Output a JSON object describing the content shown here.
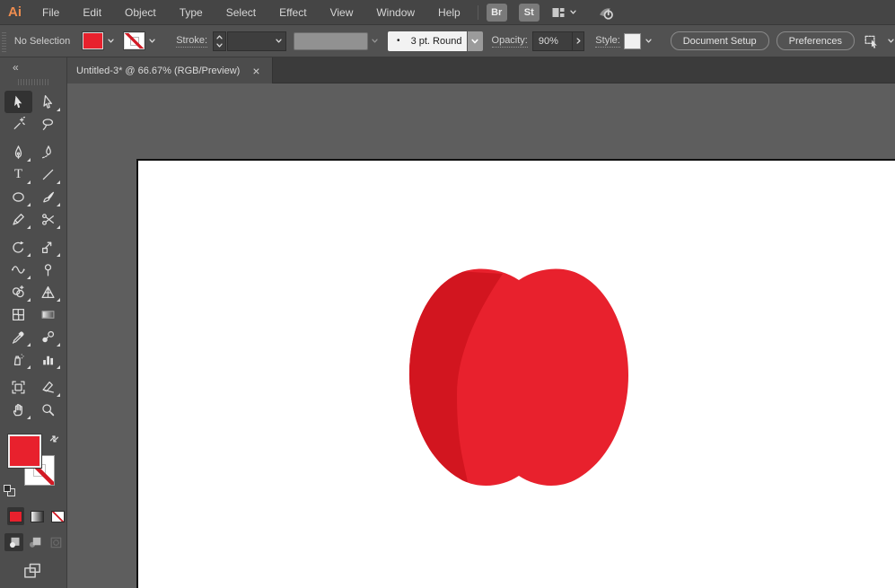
{
  "menubar": {
    "logo_label": "Ai",
    "items": [
      "File",
      "Edit",
      "Object",
      "Type",
      "Select",
      "Effect",
      "View",
      "Window",
      "Help"
    ],
    "bridge_label": "Br",
    "stock_label": "St"
  },
  "controlbar": {
    "selection_status": "No Selection",
    "stroke_label": "Stroke:",
    "brush_dot": "•",
    "brush_name": "3 pt. Round",
    "opacity_label": "Opacity:",
    "opacity_value": "90%",
    "style_label": "Style:",
    "document_setup_label": "Document Setup",
    "preferences_label": "Preferences"
  },
  "document_tab": {
    "title": "Untitled-3* @ 66.67% (RGB/Preview)",
    "close_glyph": "×"
  },
  "tools_panel": {
    "collapse_glyph": "«"
  },
  "tools": [
    {
      "name": "selection-tool",
      "selected": true,
      "flyout": false
    },
    {
      "name": "direct-selection-tool",
      "selected": false,
      "flyout": true
    },
    {
      "name": "magic-wand-tool",
      "selected": false,
      "flyout": false
    },
    {
      "name": "lasso-tool",
      "selected": false,
      "flyout": false
    },
    {
      "name": "pen-tool",
      "selected": false,
      "flyout": true
    },
    {
      "name": "curvature-tool",
      "selected": false,
      "flyout": false
    },
    {
      "name": "type-tool",
      "selected": false,
      "flyout": true
    },
    {
      "name": "line-segment-tool",
      "selected": false,
      "flyout": true
    },
    {
      "name": "ellipse-tool",
      "selected": false,
      "flyout": true
    },
    {
      "name": "paintbrush-tool",
      "selected": false,
      "flyout": true
    },
    {
      "name": "shaper-tool",
      "selected": false,
      "flyout": true
    },
    {
      "name": "scissors-tool",
      "selected": false,
      "flyout": true
    },
    {
      "name": "rotate-tool",
      "selected": false,
      "flyout": true
    },
    {
      "name": "scale-tool",
      "selected": false,
      "flyout": true
    },
    {
      "name": "width-tool",
      "selected": false,
      "flyout": true
    },
    {
      "name": "puppet-warp-tool",
      "selected": false,
      "flyout": false
    },
    {
      "name": "shape-builder-tool",
      "selected": false,
      "flyout": true
    },
    {
      "name": "perspective-grid-tool",
      "selected": false,
      "flyout": true
    },
    {
      "name": "mesh-tool",
      "selected": false,
      "flyout": false
    },
    {
      "name": "gradient-tool",
      "selected": false,
      "flyout": false
    },
    {
      "name": "eyedropper-tool",
      "selected": false,
      "flyout": true
    },
    {
      "name": "blend-tool",
      "selected": false,
      "flyout": true
    },
    {
      "name": "symbol-sprayer-tool",
      "selected": false,
      "flyout": true
    },
    {
      "name": "column-graph-tool",
      "selected": false,
      "flyout": true
    },
    {
      "name": "artboard-tool",
      "selected": false,
      "flyout": false
    },
    {
      "name": "slice-tool",
      "selected": false,
      "flyout": true
    },
    {
      "name": "hand-tool",
      "selected": false,
      "flyout": true
    },
    {
      "name": "zoom-tool",
      "selected": false,
      "flyout": false
    }
  ],
  "bottom_controls": {
    "swatches": [
      {
        "name": "color-swatch-button",
        "kind": "color",
        "pressed": true
      },
      {
        "name": "gradient-swatch-button",
        "kind": "gradient",
        "pressed": false
      },
      {
        "name": "none-swatch-button",
        "kind": "none",
        "pressed": false
      }
    ],
    "modes": [
      {
        "name": "draw-normal-button",
        "icon": "draw-normal-icon",
        "pressed": true,
        "disabled": false
      },
      {
        "name": "draw-behind-button",
        "icon": "draw-behind-icon",
        "pressed": false,
        "disabled": false
      },
      {
        "name": "draw-inside-button",
        "icon": "draw-inside-icon",
        "pressed": false,
        "disabled": true
      }
    ]
  },
  "colors": {
    "fill_red": "#e8212d",
    "apple_body": "#e8212d",
    "apple_shade": "#d2151f",
    "style_swatch": "#f0f0f0"
  },
  "artwork": {
    "shape": "apple"
  }
}
